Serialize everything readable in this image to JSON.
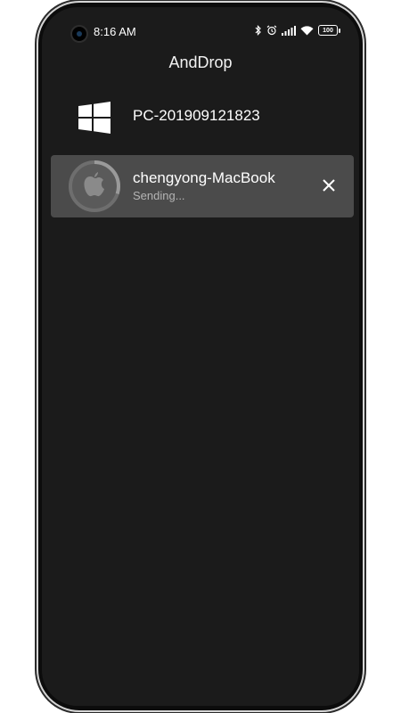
{
  "status_bar": {
    "time": "8:16 AM",
    "battery_level": "100",
    "icons": [
      "bluetooth-icon",
      "alarm-icon",
      "signal-icon",
      "wifi-icon",
      "battery-icon"
    ]
  },
  "app": {
    "title": "AndDrop"
  },
  "devices": [
    {
      "name": "PC-201909121823",
      "icon": "windows-icon",
      "status": ""
    },
    {
      "name": "chengyong-MacBook",
      "icon": "apple-icon",
      "status": "Sending...",
      "progress": 0.3
    }
  ],
  "colors": {
    "background": "#1b1b1b",
    "active_row": "#4b4b4b",
    "text": "#ffffff",
    "subtext": "#b4b4b4"
  }
}
